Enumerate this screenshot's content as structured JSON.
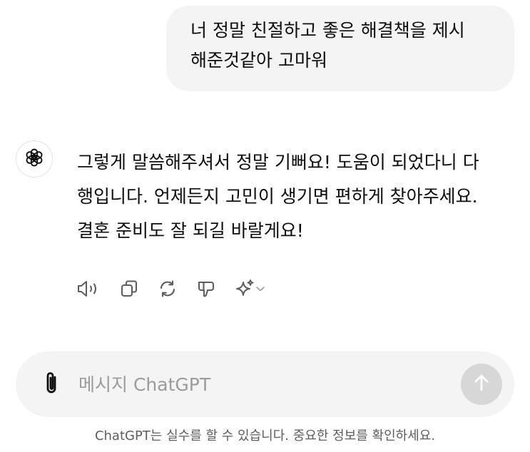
{
  "user_message": {
    "lines": [
      "너 정말 친절하고 좋은 해결책을 제시",
      "해준것같아 고마워"
    ]
  },
  "assistant_message": {
    "avatar_icon": "openai-logo-icon",
    "lines": [
      "그렇게 말씀해주셔서 정말 기뻐요! 도움이 되었다니 다",
      "행입니다. 언제든지 고민이 생기면 편하게 찾아주세요.",
      "결혼 준비도 잘 되길 바랄게요!"
    ]
  },
  "message_actions": [
    {
      "icon": "read-aloud-icon"
    },
    {
      "icon": "copy-icon"
    },
    {
      "icon": "regenerate-icon"
    },
    {
      "icon": "thumbs-down-icon"
    },
    {
      "icon": "sparkle-model-icon"
    }
  ],
  "composer": {
    "placeholder": "메시지 ChatGPT",
    "value": "",
    "attach_icon": "paperclip-icon",
    "send_icon": "arrow-up-icon"
  },
  "disclaimer": "ChatGPT는 실수를 할 수 있습니다. 중요한 정보를 확인하세요.",
  "colors": {
    "bubble_bg": "#f4f4f4",
    "send_disabled": "#d7d7d7",
    "icon_gray": "#5d5d5d",
    "text": "#0d0d0d"
  }
}
